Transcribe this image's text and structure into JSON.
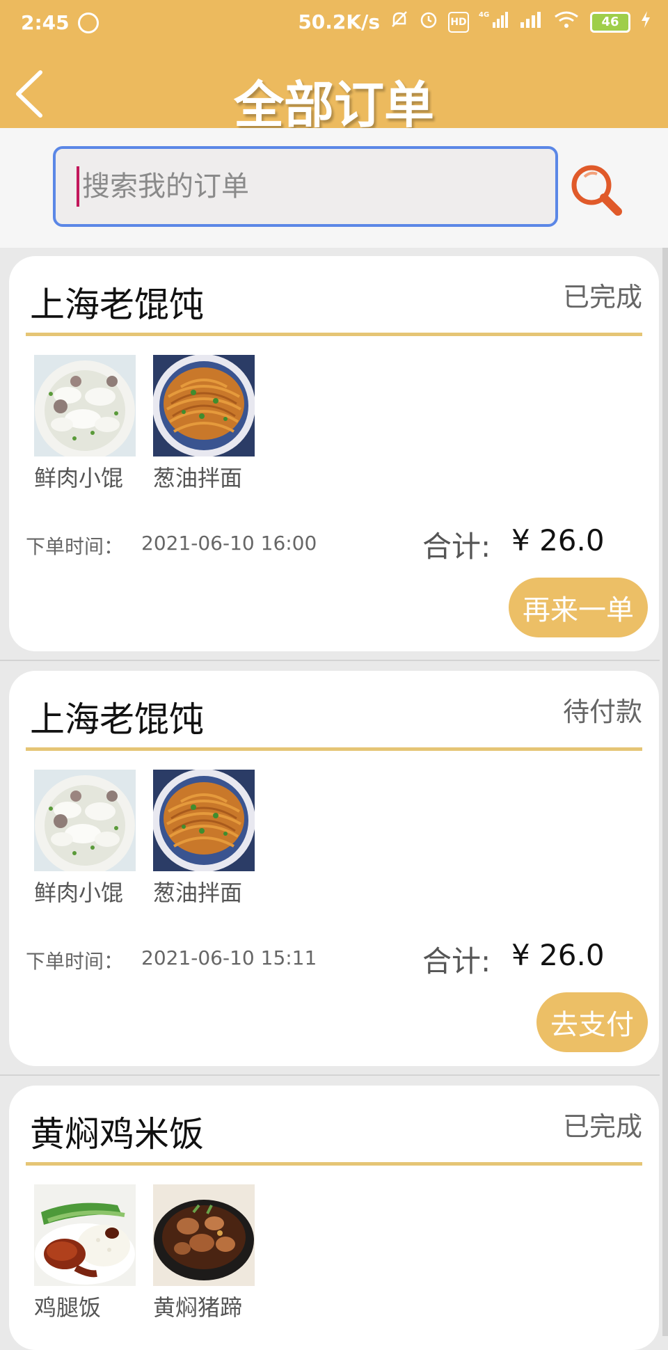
{
  "status_bar": {
    "time": "2:45",
    "network_speed": "50.2K/s",
    "battery": "46",
    "hd_label": "HD",
    "net_label": "4G"
  },
  "header": {
    "title": "全部订单"
  },
  "search": {
    "placeholder": "搜索我的订单",
    "value": ""
  },
  "orders": [
    {
      "shop": "上海老馄饨",
      "status": "已完成",
      "items": [
        {
          "name": "鲜肉小馄",
          "image": "wonton-soup"
        },
        {
          "name": "葱油拌面",
          "image": "scallion-oil-noodles"
        }
      ],
      "time_label": "下单时间：",
      "time": "2021-06-10 16:00",
      "total_label": "合计:",
      "total": "¥ 26.0",
      "action": "再来一单"
    },
    {
      "shop": "上海老馄饨",
      "status": "待付款",
      "items": [
        {
          "name": "鲜肉小馄",
          "image": "wonton-soup"
        },
        {
          "name": "葱油拌面",
          "image": "scallion-oil-noodles"
        }
      ],
      "time_label": "下单时间：",
      "time": "2021-06-10 15:11",
      "total_label": "合计:",
      "total": "¥ 26.0",
      "action": "去支付"
    },
    {
      "shop": "黄焖鸡米饭",
      "status": "已完成",
      "items": [
        {
          "name": "鸡腿饭",
          "image": "chicken-leg-rice"
        },
        {
          "name": "黄焖猪蹄",
          "image": "braised-pork-trotters"
        }
      ]
    }
  ],
  "colors": {
    "header": "#ecba5e",
    "accent_line": "#e5c575",
    "button": "#ecbf66",
    "search_border": "#5b87e6"
  }
}
